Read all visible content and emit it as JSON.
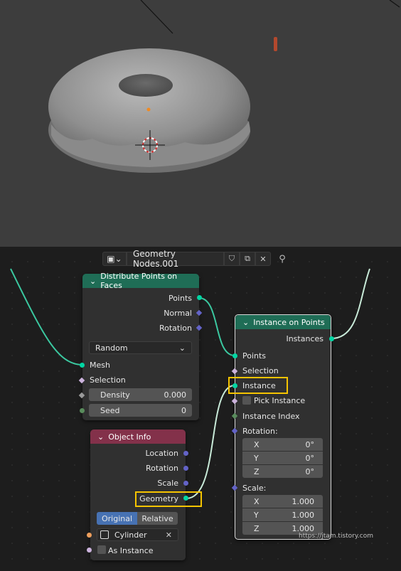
{
  "header": {
    "node_tree_name": "Geometry Nodes.001"
  },
  "distribute": {
    "title": "Distribute Points on Faces",
    "out_points": "Points",
    "out_normal": "Normal",
    "out_rotation": "Rotation",
    "mode": "Random",
    "in_mesh": "Mesh",
    "in_selection": "Selection",
    "density_label": "Density",
    "density_value": "0.000",
    "seed_label": "Seed",
    "seed_value": "0"
  },
  "object_info": {
    "title": "Object Info",
    "out_location": "Location",
    "out_rotation": "Rotation",
    "out_scale": "Scale",
    "out_geometry": "Geometry",
    "tab_original": "Original",
    "tab_relative": "Relative",
    "object_name": "Cylinder",
    "as_instance": "As Instance"
  },
  "instance_on_points": {
    "title": "Instance on Points",
    "out_instances": "Instances",
    "in_points": "Points",
    "in_selection": "Selection",
    "in_instance": "Instance",
    "pick_instance": "Pick Instance",
    "instance_index": "Instance Index",
    "rotation_label": "Rotation:",
    "rotation": [
      {
        "axis": "X",
        "value": "0°"
      },
      {
        "axis": "Y",
        "value": "0°"
      },
      {
        "axis": "Z",
        "value": "0°"
      }
    ],
    "scale_label": "Scale:",
    "scale": [
      {
        "axis": "X",
        "value": "1.000"
      },
      {
        "axis": "Y",
        "value": "1.000"
      },
      {
        "axis": "Z",
        "value": "1.000"
      }
    ]
  },
  "watermark": "https://jtam.tistory.com",
  "colors": {
    "geometry_socket": "#00d6a3",
    "vector_socket": "#6363c7",
    "bool_socket": "#ccb3dd",
    "int_socket": "#598c5c",
    "object_socket": "#ed9e5c",
    "distribute_header": "#1f6d56",
    "object_info_header": "#83314a",
    "highlight": "#f5c400",
    "active_tab": "#4772b3"
  }
}
